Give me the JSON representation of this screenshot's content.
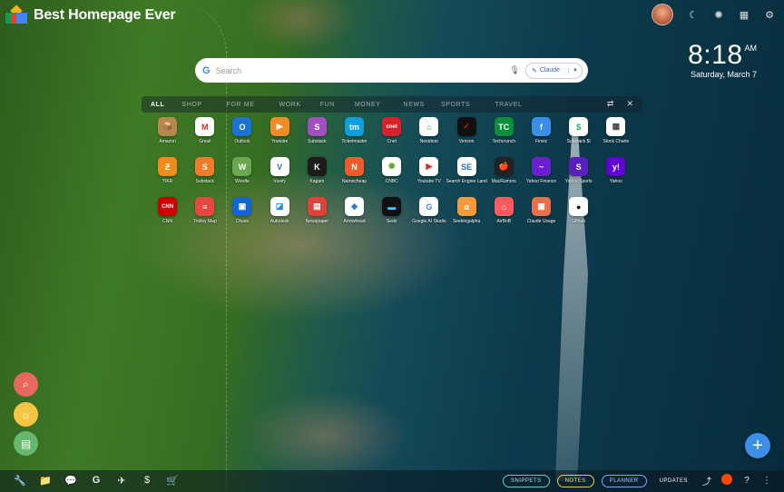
{
  "brand": {
    "title": "Best Homepage Ever",
    "logo_icon": "cube-logo-icon"
  },
  "clock": {
    "time": "8:18",
    "ampm": "AM",
    "date": "Saturday, March 7"
  },
  "top_icons": [
    "moon-icon",
    "bug-icon",
    "calendar-icon",
    "gear-icon"
  ],
  "search": {
    "placeholder": "Search",
    "ai_label": "Claude",
    "mic_icon": "mic-icon"
  },
  "tabs": [
    "ALL",
    "SHOP",
    "FOR ME",
    "WORK",
    "FUN",
    "MONEY",
    "NEWS",
    "SPORTS",
    "TRAVEL"
  ],
  "active_tab": "ALL",
  "tab_tools": [
    "swap-icon",
    "magic-wand-off-icon"
  ],
  "apps": [
    {
      "label": "Amazon",
      "color": "#b7874e",
      "glyph": "📦"
    },
    {
      "label": "Gmail",
      "color": "#ffffff",
      "glyph": "M",
      "fg": "#d93025"
    },
    {
      "label": "Outlook",
      "color": "#1a73d4",
      "glyph": "O"
    },
    {
      "label": "Youtube",
      "color": "#f28b24",
      "glyph": "▶"
    },
    {
      "label": "Substack",
      "color": "#a24fc2",
      "glyph": "S"
    },
    {
      "label": "Ticketmaster",
      "color": "#0e9fe0",
      "glyph": "tm"
    },
    {
      "label": "Cnet",
      "color": "#d6222a",
      "glyph": "cnet"
    },
    {
      "label": "Nextdoor",
      "color": "#ffffff",
      "glyph": "⌂",
      "fg": "#1b9e3e"
    },
    {
      "label": "Verizon",
      "color": "#111111",
      "glyph": "✓",
      "fg": "#e11"
    },
    {
      "label": "Techcrunch",
      "color": "#0c8f3b",
      "glyph": "TC"
    },
    {
      "label": "Finviz",
      "color": "#3a8ee8",
      "glyph": "f"
    },
    {
      "label": "Substack $I",
      "color": "#ffffff",
      "glyph": "$",
      "fg": "#2a6"
    },
    {
      "label": "Stock Charts",
      "color": "#ffffff",
      "glyph": "▦",
      "fg": "#444"
    },
    {
      "label": "TIKR",
      "color": "#f08c1e",
      "glyph": "Ƶ"
    },
    {
      "label": "Substack",
      "color": "#f07b2a",
      "glyph": "S"
    },
    {
      "label": "Wordle",
      "color": "#6aa84f",
      "glyph": "W"
    },
    {
      "label": "Vueify",
      "color": "#ffffff",
      "glyph": "V",
      "fg": "#2b6de0"
    },
    {
      "label": "Kagam",
      "color": "#1c1c1c",
      "glyph": "K"
    },
    {
      "label": "Namecheap",
      "color": "#f1592a",
      "glyph": "N"
    },
    {
      "label": "CNBC",
      "color": "#ffffff",
      "glyph": "✺",
      "fg": "#6a3"
    },
    {
      "label": "Youtube TV",
      "color": "#ffffff",
      "glyph": "▶",
      "fg": "#e22"
    },
    {
      "label": "Search Engine Land",
      "color": "#ffffff",
      "glyph": "SE",
      "fg": "#2a6ad0"
    },
    {
      "label": "MacRumors",
      "color": "#222222",
      "glyph": "🍎"
    },
    {
      "label": "Yahoo Finance",
      "color": "#6a1fd1",
      "glyph": "~"
    },
    {
      "label": "Yahoo Sports",
      "color": "#5a1fbf",
      "glyph": "S"
    },
    {
      "label": "Yahoo",
      "color": "#6001d2",
      "glyph": "y!"
    },
    {
      "label": "CNN",
      "color": "#cc0000",
      "glyph": "CNN"
    },
    {
      "label": "Trolley Map",
      "color": "#e8473f",
      "glyph": "≡"
    },
    {
      "label": "Chase",
      "color": "#1166d4",
      "glyph": "▣"
    },
    {
      "label": "Autodesk",
      "color": "#ffffff",
      "glyph": "◪",
      "fg": "#1e88e5"
    },
    {
      "label": "Newspaper",
      "color": "#e2413a",
      "glyph": "▤"
    },
    {
      "label": "Arrowhead",
      "color": "#ffffff",
      "glyph": "◆",
      "fg": "#2b7bd0"
    },
    {
      "label": "Sedo",
      "color": "#111111",
      "glyph": "▬",
      "fg": "#4cf"
    },
    {
      "label": "Google AI Studio",
      "color": "#ffffff",
      "glyph": "G",
      "fg": "#4285f4"
    },
    {
      "label": "Seekingalpha",
      "color": "#f59a3b",
      "glyph": "α"
    },
    {
      "label": "AirBnB",
      "color": "#ff5a5f",
      "glyph": "⌂"
    },
    {
      "label": "Claude Usage",
      "color": "#e86f4a",
      "glyph": "▣"
    },
    {
      "label": "Github",
      "color": "#ffffff",
      "glyph": "●",
      "fg": "#111"
    }
  ],
  "left_floating": [
    {
      "icon": "map-search-icon",
      "color": "#e8675e"
    },
    {
      "icon": "sun-icon",
      "color": "#f4c542"
    },
    {
      "icon": "newspaper-icon",
      "color": "#66b86c"
    }
  ],
  "bottom_left_icons": [
    "wrench-icon",
    "folder-icon",
    "chat-icon",
    "google-icon",
    "airplane-icon",
    "dollar-icon",
    "cart-icon"
  ],
  "bottom_right": {
    "snippets": "SNIPPETS",
    "notes": "NOTES",
    "planner": "PLANNER",
    "updates": "UPDATES"
  },
  "bottom_right_icons": [
    "upload-icon",
    "reddit-icon",
    "help-icon",
    "more-vertical-icon"
  ]
}
